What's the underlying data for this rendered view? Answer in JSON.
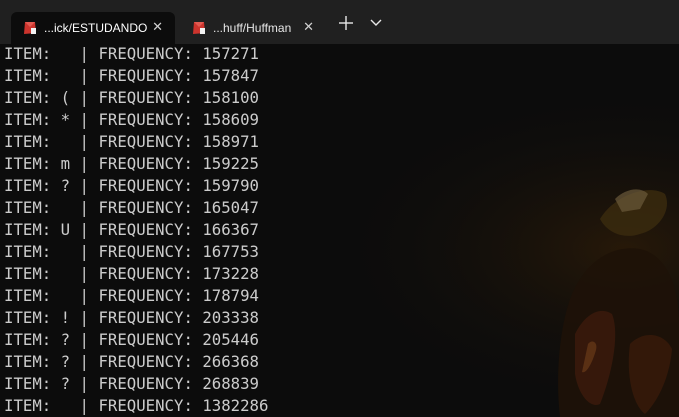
{
  "tabs": [
    {
      "label": "...ick/ESTUDANDO",
      "icon": "ruby-icon",
      "active": true
    },
    {
      "label": "...huff/Huffman",
      "icon": "ruby-icon",
      "active": false
    }
  ],
  "tab_close_glyph": "✕",
  "new_tab_glyph": "+",
  "output_lines": [
    "ITEM:   | FREQUENCY: 157271",
    "ITEM:   | FREQUENCY: 157847",
    "ITEM: ( | FREQUENCY: 158100",
    "ITEM: * | FREQUENCY: 158609",
    "ITEM:   | FREQUENCY: 158971",
    "ITEM: m | FREQUENCY: 159225",
    "ITEM: ? | FREQUENCY: 159790",
    "ITEM:   | FREQUENCY: 165047",
    "ITEM: U | FREQUENCY: 166367",
    "ITEM:   | FREQUENCY: 167753",
    "ITEM:   | FREQUENCY: 173228",
    "ITEM:   | FREQUENCY: 178794",
    "ITEM: ! | FREQUENCY: 203338",
    "ITEM: ? | FREQUENCY: 205446",
    "ITEM: ? | FREQUENCY: 266368",
    "ITEM: ? | FREQUENCY: 268839",
    "ITEM:   | FREQUENCY: 1382286"
  ],
  "colors": {
    "tabbar_bg": "#202020",
    "terminal_bg": "#0c0c0c",
    "text": "#cccccc",
    "ruby_red": "#cc342d"
  }
}
